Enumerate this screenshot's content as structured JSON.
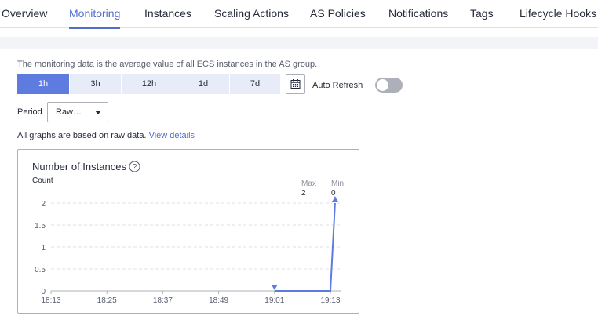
{
  "tabs": [
    {
      "label": "Overview",
      "active": false
    },
    {
      "label": "Monitoring",
      "active": true
    },
    {
      "label": "Instances",
      "active": false
    },
    {
      "label": "Scaling Actions",
      "active": false
    },
    {
      "label": "AS Policies",
      "active": false
    },
    {
      "label": "Notifications",
      "active": false
    },
    {
      "label": "Tags",
      "active": false
    },
    {
      "label": "Lifecycle Hooks",
      "active": false
    }
  ],
  "monitoring": {
    "info_text": "The monitoring data is the average value of all ECS instances in the AS group.",
    "time_ranges": [
      {
        "label": "1h",
        "active": true
      },
      {
        "label": "3h",
        "active": false
      },
      {
        "label": "12h",
        "active": false
      },
      {
        "label": "1d",
        "active": false
      },
      {
        "label": "7d",
        "active": false
      }
    ],
    "calendar_icon": "calendar-icon",
    "auto_refresh_label": "Auto Refresh",
    "auto_refresh_on": false,
    "period_label": "Period",
    "period_value": "Raw…",
    "raw_note": "All graphs are based on raw data.",
    "view_details_label": "View details"
  },
  "chart": {
    "title": "Number of Instances",
    "unit_label": "Count",
    "max_label": "Max",
    "max_value": "2",
    "min_label": "Min",
    "min_value": "0",
    "colors": {
      "line": "#5e7ce0",
      "grid": "#dfe1e6",
      "axis": "#adb0b8"
    }
  },
  "chart_data": {
    "type": "line",
    "title": "Number of Instances",
    "ylabel": "Count",
    "xlabel": "",
    "x_ticks": [
      "18:13",
      "18:25",
      "18:37",
      "18:49",
      "19:01",
      "19:13"
    ],
    "y_ticks": [
      "0",
      "0.5",
      "1",
      "1.5",
      "2"
    ],
    "ylim": [
      0,
      2
    ],
    "grid": true,
    "series": [
      {
        "x": [
          "19:01",
          "19:13",
          "19:14"
        ],
        "values": [
          0,
          0,
          2
        ],
        "min_marker": {
          "x": "19:01",
          "y": 0
        },
        "max_marker": {
          "x": "19:14",
          "y": 2
        }
      }
    ]
  }
}
